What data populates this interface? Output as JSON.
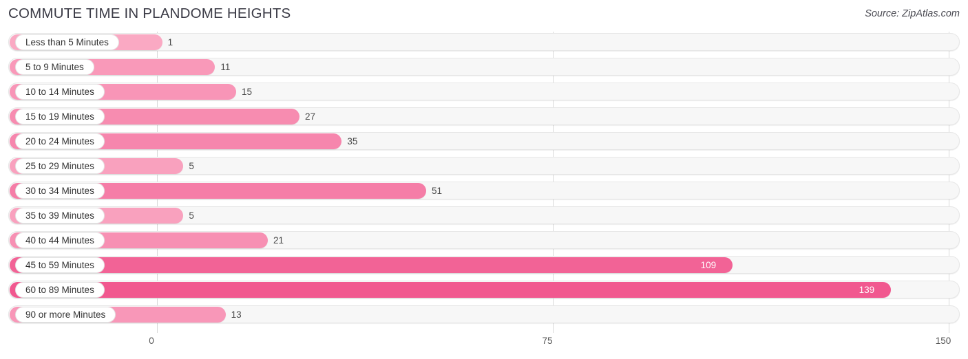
{
  "header": {
    "title": "COMMUTE TIME IN PLANDOME HEIGHTS",
    "source": "Source: ZipAtlas.com"
  },
  "colors": {
    "bar_min": "#fbafc7",
    "bar_max": "#f1588f",
    "track": "#f7f7f7",
    "gridline": "#d9d9d9",
    "label_text": "#333333",
    "value_text": "#4a4a4a",
    "value_text_inside": "#ffffff"
  },
  "chart_data": {
    "type": "bar",
    "orientation": "horizontal",
    "title": "COMMUTE TIME IN PLANDOME HEIGHTS",
    "xlabel": "",
    "ylabel": "",
    "xlim": [
      0,
      150
    ],
    "ticks": [
      "0",
      "75",
      "150"
    ],
    "tick_values": [
      0,
      75,
      150
    ],
    "grid": true,
    "legend": false,
    "categories": [
      "Less than 5 Minutes",
      "5 to 9 Minutes",
      "10 to 14 Minutes",
      "15 to 19 Minutes",
      "20 to 24 Minutes",
      "25 to 29 Minutes",
      "30 to 34 Minutes",
      "35 to 39 Minutes",
      "40 to 44 Minutes",
      "45 to 59 Minutes",
      "60 to 89 Minutes",
      "90 or more Minutes"
    ],
    "values": [
      1,
      11,
      15,
      27,
      35,
      5,
      51,
      5,
      21,
      109,
      139,
      13
    ],
    "value_labels": [
      "1",
      "11",
      "15",
      "27",
      "35",
      "5",
      "51",
      "5",
      "21",
      "109",
      "139",
      "13"
    ]
  }
}
